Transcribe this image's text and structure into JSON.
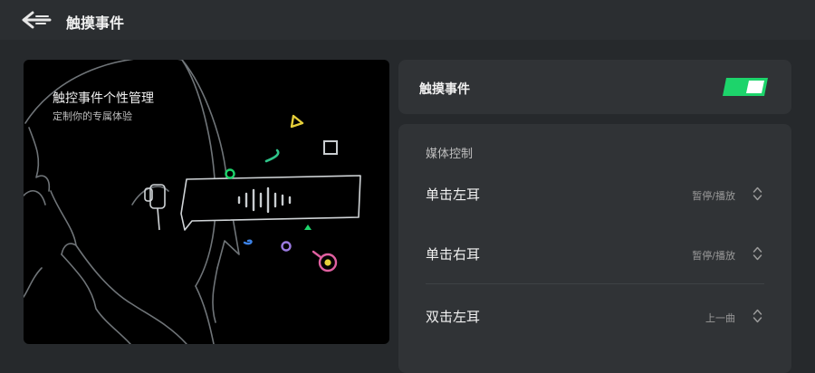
{
  "header": {
    "title": "触摸事件",
    "back_icon": "back-arrow-icon"
  },
  "hero": {
    "title": "触控事件个性管理",
    "subtitle": "定制你的专属体验",
    "illustration": "earbud-sound-wave-illustration"
  },
  "touch_toggle": {
    "label": "触摸事件",
    "enabled": true,
    "accent_color": "#1dd46b"
  },
  "media_control": {
    "section_label": "媒体控制",
    "rows": [
      {
        "label": "单击左耳",
        "value": "暂停/播放"
      },
      {
        "label": "单击右耳",
        "value": "暂停/播放"
      },
      {
        "label": "双击左耳",
        "value": "上一曲"
      }
    ],
    "chevron_icon": "up-down-chevron-icon"
  }
}
